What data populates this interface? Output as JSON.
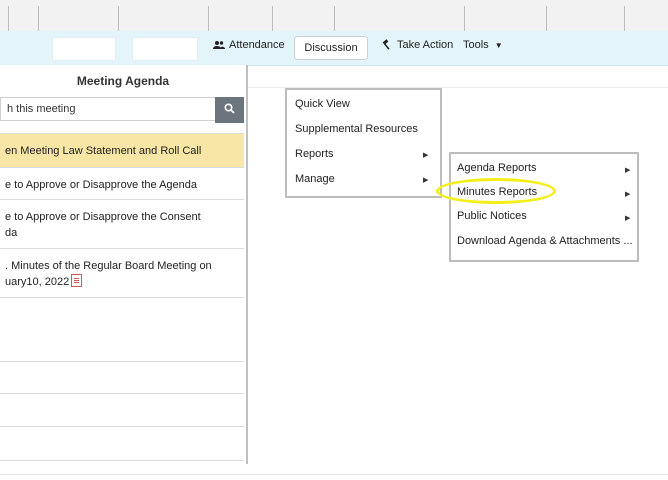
{
  "toolbar": {
    "attendance": "Attendance",
    "discussion": "Discussion",
    "take_action": "Take Action",
    "tools": "Tools"
  },
  "agenda": {
    "title": "Meeting Agenda",
    "search_value": "h this meeting",
    "items": [
      {
        "lines": [
          "en Meeting Law Statement and Roll Call"
        ],
        "active": true
      },
      {
        "lines": [
          "e to Approve or Disapprove the Agenda"
        ],
        "active": false
      },
      {
        "lines": [
          "e to Approve or Disapprove the Consent",
          "da"
        ],
        "active": false
      },
      {
        "lines": [
          ". Minutes of the Regular Board Meeting on",
          "uary10, 2022"
        ],
        "active": false,
        "attachment_icon": "pdf-icon"
      }
    ]
  },
  "context_menu": {
    "items": [
      "Quick View",
      "Supplemental Resources",
      "Reports",
      "Manage"
    ]
  },
  "reports_submenu": {
    "items": [
      "Agenda Reports",
      "Minutes Reports",
      "Public Notices",
      "Download Agenda & Attachments ..."
    ],
    "highlighted": "Minutes Reports"
  },
  "icons": {
    "attendance": "users-icon",
    "take_action": "gavel-icon",
    "search": "search-icon",
    "caret": "caret-down-icon",
    "submenu_arrow": "triangle-right-icon"
  },
  "colors": {
    "toolbar_bg": "#e3f5fa",
    "active_item_bg": "#f7e6a5",
    "search_btn": "#6c757d",
    "highlight_ring": "#f4ef1a"
  }
}
